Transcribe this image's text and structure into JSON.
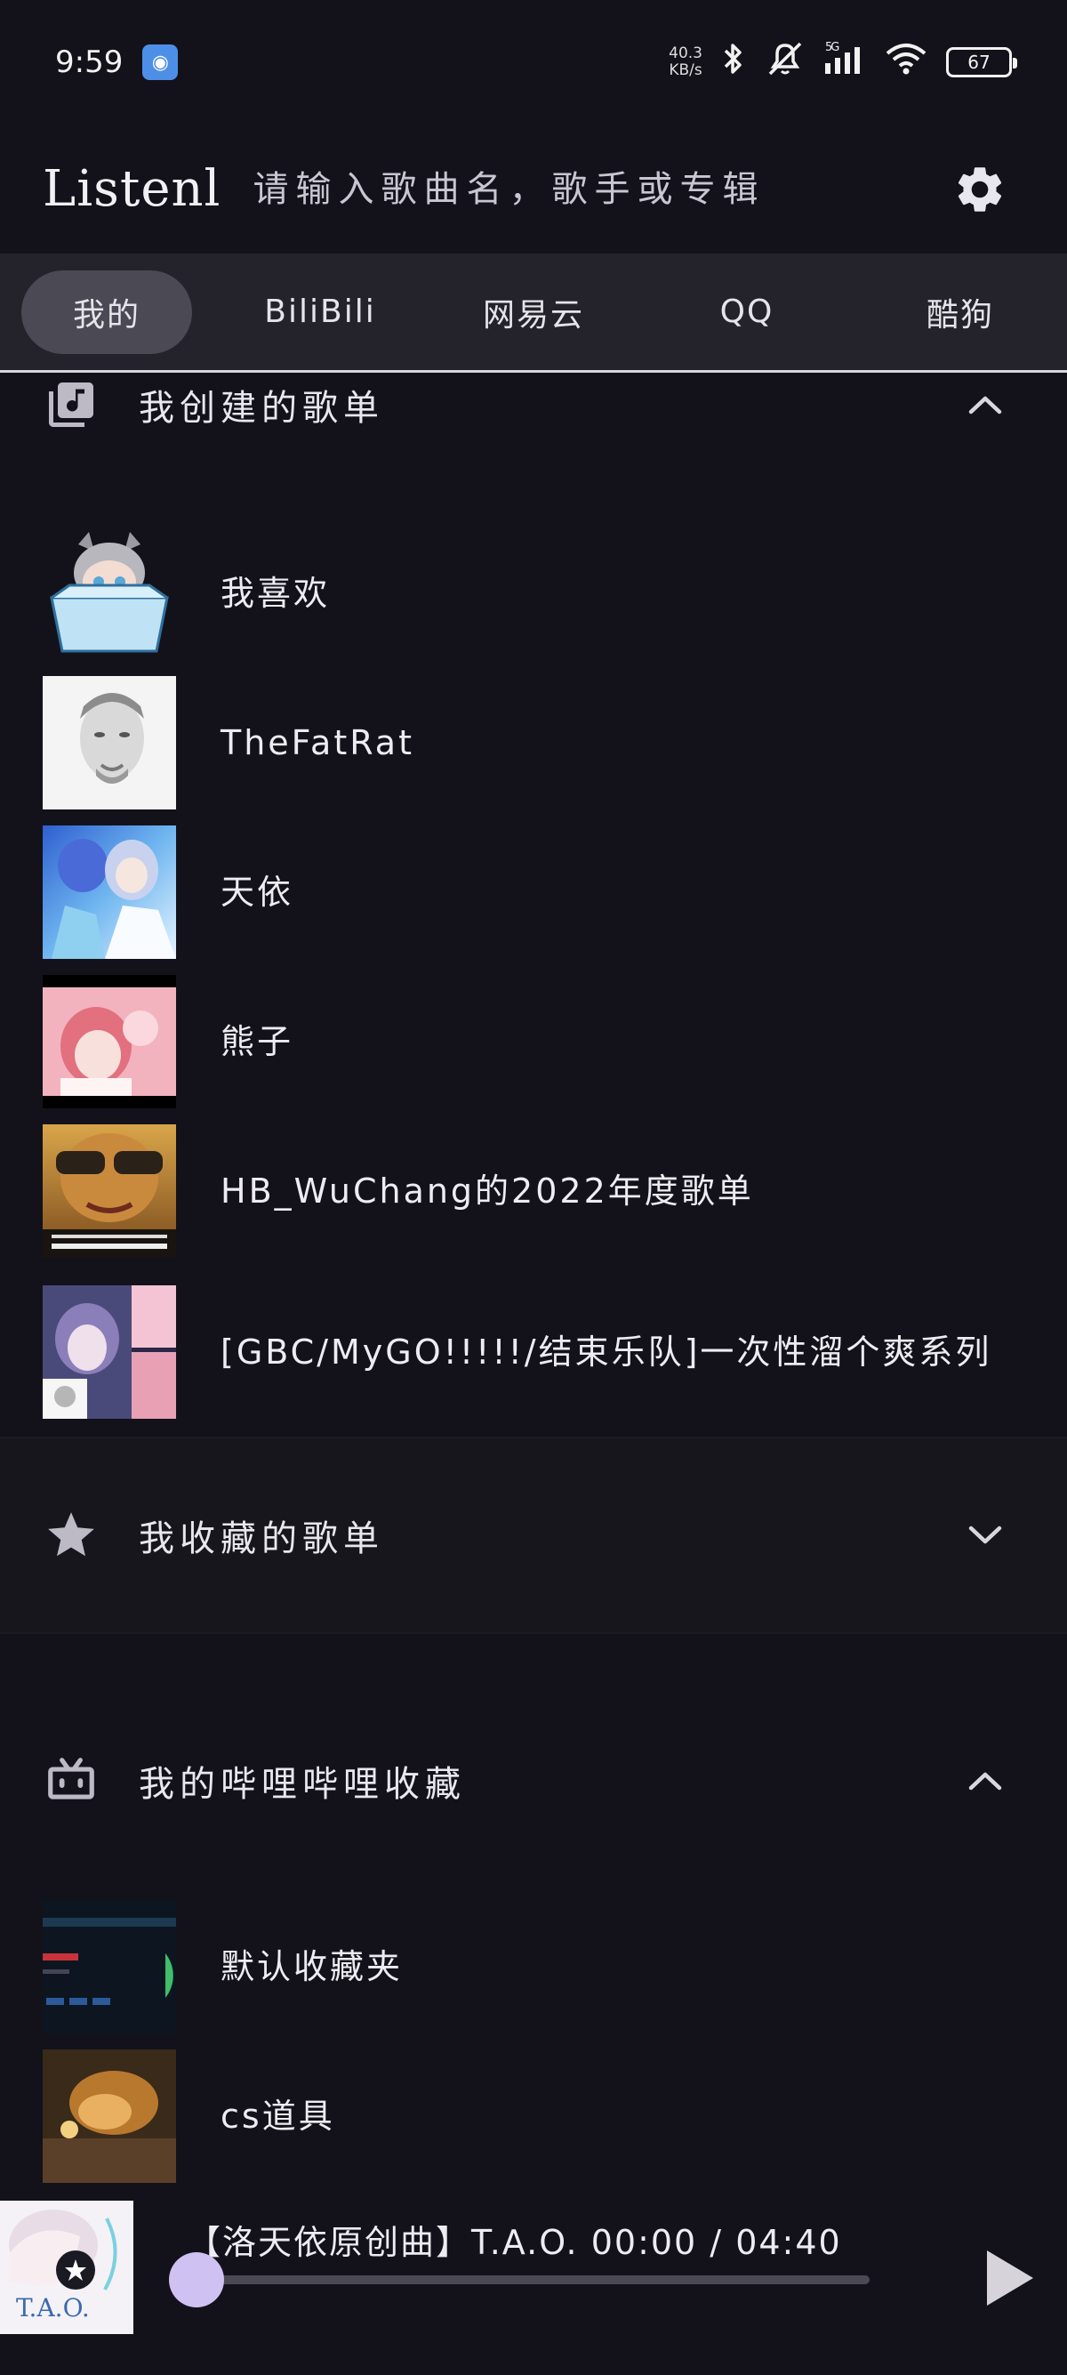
{
  "status_bar": {
    "time": "9:59",
    "net_speed_value": "40.3",
    "net_speed_unit": "KB/s",
    "network": "5G",
    "battery": "67"
  },
  "header": {
    "logo": "Listenl",
    "search_placeholder": "请输入歌曲名，歌手或专辑"
  },
  "tabs": [
    {
      "label": "我的",
      "active": true
    },
    {
      "label": "BiliBili",
      "active": false
    },
    {
      "label": "网易云",
      "active": false
    },
    {
      "label": "QQ",
      "active": false
    },
    {
      "label": "酷狗",
      "active": false
    }
  ],
  "sections": {
    "created": {
      "title": "我创建的歌单",
      "items": [
        {
          "label": "我喜欢"
        },
        {
          "label": "TheFatRat"
        },
        {
          "label": "天依"
        },
        {
          "label": "熊子"
        },
        {
          "label": "HB_WuChang的2022年度歌单"
        },
        {
          "label": "[GBC/MyGO!!!!!/结束乐队]一次性溜个爽系列"
        }
      ]
    },
    "favorited": {
      "title": "我收藏的歌单"
    },
    "bilibili": {
      "title": "我的哔哩哔哩收藏",
      "items": [
        {
          "label": "默认收藏夹"
        },
        {
          "label": "cs道具"
        }
      ]
    }
  },
  "player": {
    "song": "【洛天依原创曲】T.A.O. 00:00 / 04:40",
    "cover_text": "T.A.O.",
    "progress": 0
  },
  "colors": {
    "background": "#13121a",
    "tab_bar": "#24232b",
    "active_tab": "#4b4953",
    "progress_thumb": "#cfc2f2"
  }
}
